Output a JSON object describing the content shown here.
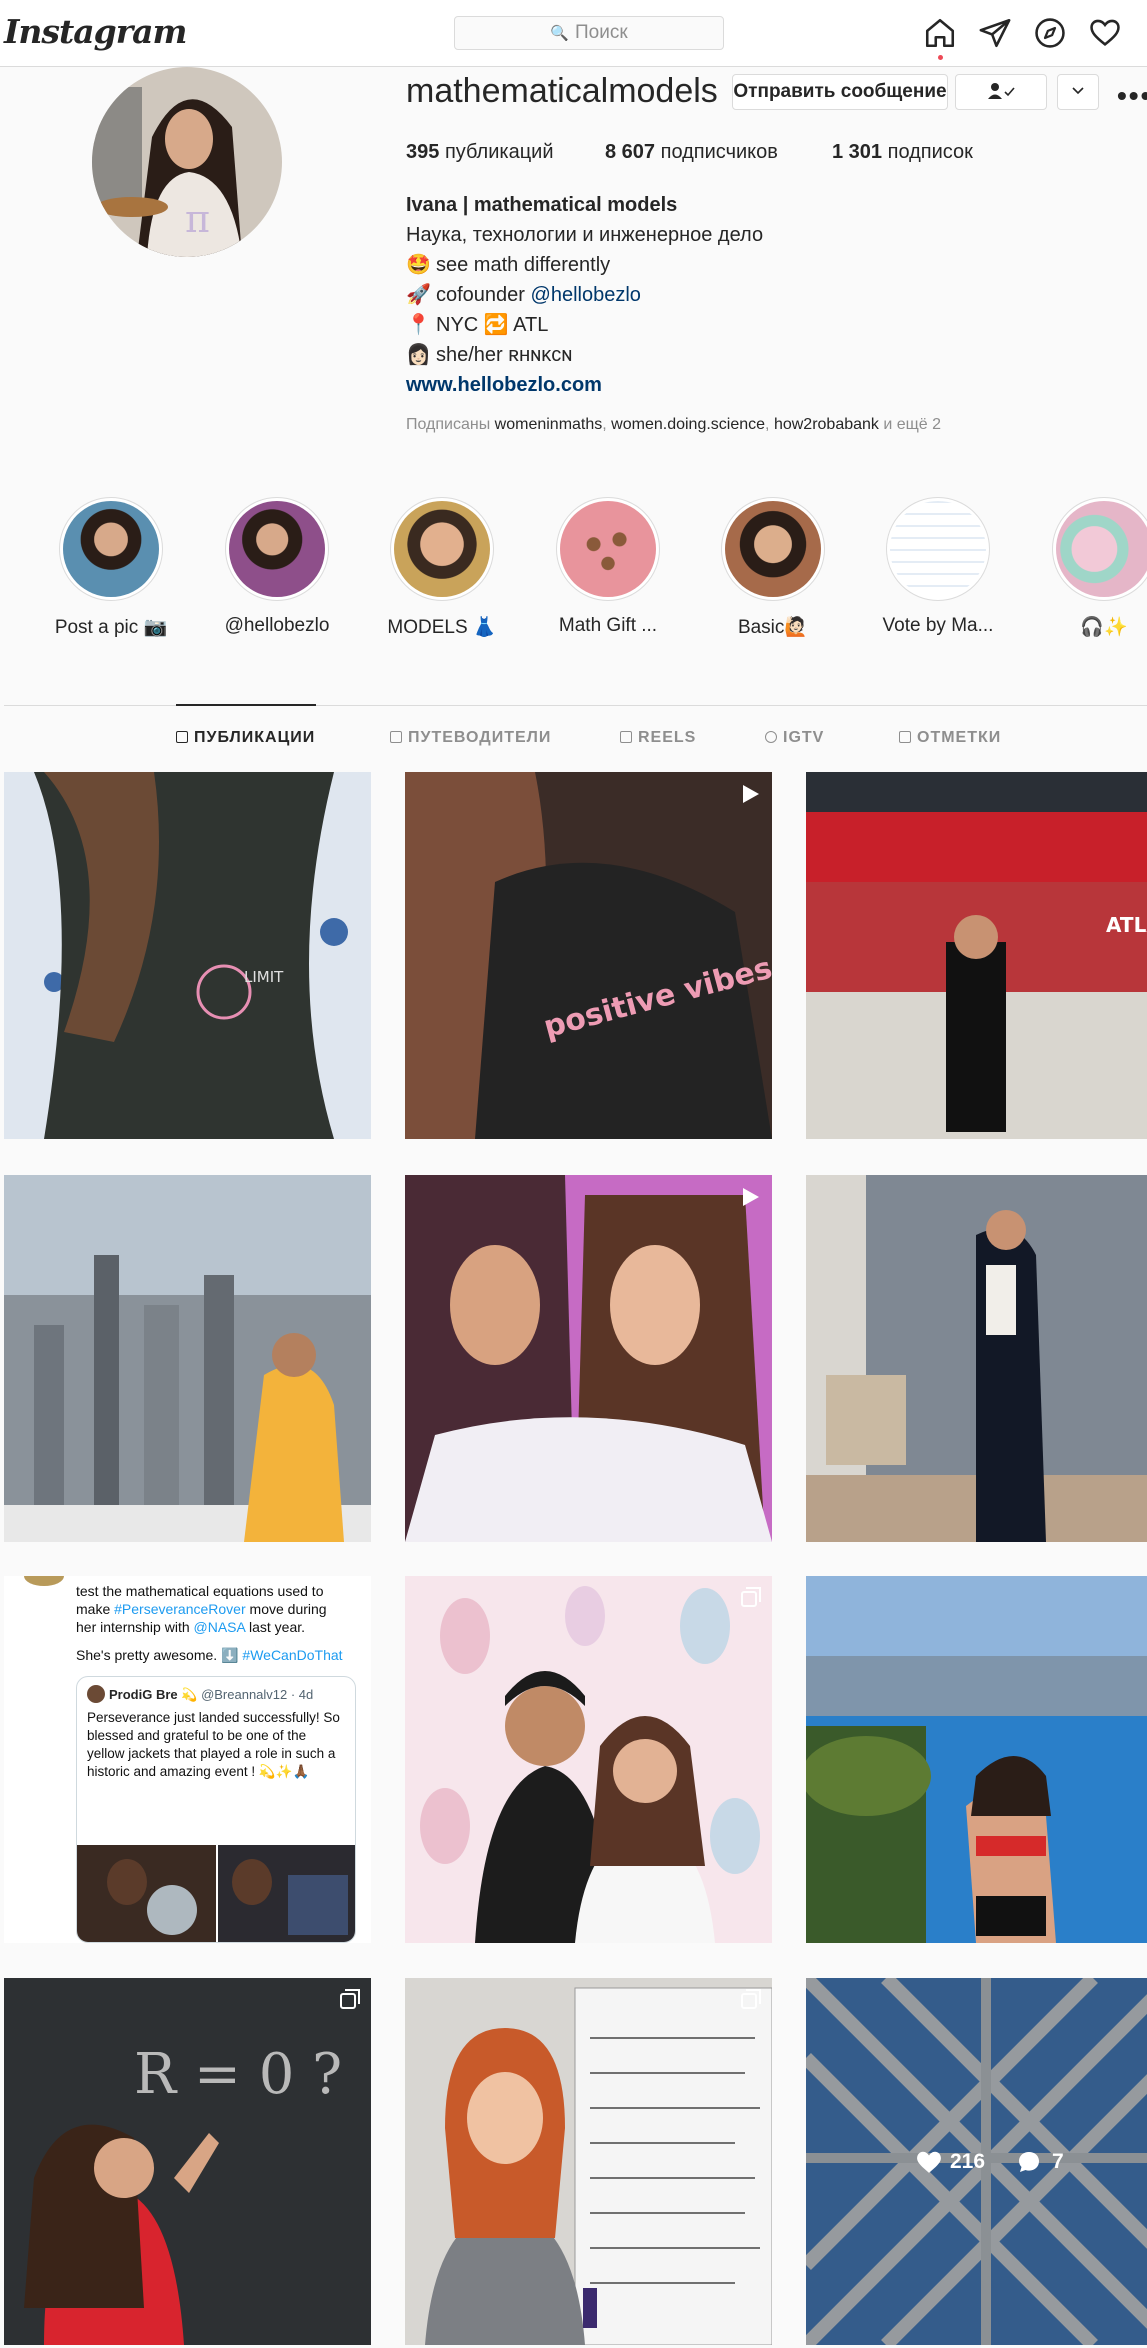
{
  "app": {
    "logo": "Instagram"
  },
  "search": {
    "placeholder": "Поиск"
  },
  "profile": {
    "username": "mathematicalmodels",
    "message_button": "Отправить сообщение",
    "stats": [
      {
        "value": "395",
        "label": "публикаций"
      },
      {
        "value": "8 607",
        "label": "подписчиков"
      },
      {
        "value": "1 301",
        "label": "подписок"
      }
    ],
    "full_name": "Ivana | mathematical models",
    "category": "Наука, технологии и инженерное дело",
    "bio_lines": [
      {
        "emoji": "🤩",
        "text": "see math differently",
        "mention": ""
      },
      {
        "emoji": "🚀",
        "text": "cofounder ",
        "mention": "@hellobezlo"
      },
      {
        "emoji": "📍",
        "text": "NYC 🔁 ATL",
        "mention": ""
      },
      {
        "emoji": "👩🏻",
        "text": "she/her ʀʜɴᴋᴄɴ",
        "mention": ""
      }
    ],
    "website": "www.hellobezlo.com",
    "followed_by": {
      "prefix": "Подписаны",
      "users": [
        "womeninmaths",
        "women.doing.science",
        "how2robabank"
      ],
      "suffix": "и ещё 2"
    }
  },
  "highlights": [
    {
      "label": "Post a pic 📷",
      "color": "#5a8fb0"
    },
    {
      "label": "@hellobezlo",
      "color": "#8e4f8a"
    },
    {
      "label": "MODELS 👗",
      "color": "#c9a35a"
    },
    {
      "label": "Math Gift ...",
      "color": "#e8949c"
    },
    {
      "label": "Basic🙋🏻",
      "color": "#a66a4a"
    },
    {
      "label": "Vote by Ma...",
      "color": "#dfe9f3"
    },
    {
      "label": "🎧✨",
      "color": "#e5b6c8"
    }
  ],
  "tabs": [
    {
      "label": "ПУБЛИКАЦИИ",
      "active": true
    },
    {
      "label": "ПУТЕВОДИТЕЛИ",
      "active": false
    },
    {
      "label": "REELS",
      "active": false
    },
    {
      "label": "IGTV",
      "active": false
    },
    {
      "label": "ОТМЕТКИ",
      "active": false
    }
  ],
  "tweet_post": {
    "line1": "test the mathematical equations used to",
    "line2_pre": "make ",
    "line2_tag": "#PerseveranceRover",
    "line2_post": " move during",
    "line3_pre": "her internship with ",
    "line3_tag": "@NASA",
    "line3_post": " last year.",
    "line4_pre": "She's pretty awesome. ⬇️ ",
    "line4_tag": "#WeCanDoThat",
    "quote_author": "ProdiG Bre 💫",
    "quote_handle": "@Breannalv12 · 4d",
    "quote_text": "Perseverance just landed successfully! So blessed and grateful to be one of the yellow jackets that played a role in such a historic and amazing event ! 💫✨🙏🏾"
  },
  "hover_stats": {
    "likes": "216",
    "comments": "7"
  },
  "photo_text": {
    "shirt_text": "positive vibes ONLY",
    "stadium_sign": "ATLANTA",
    "board_text": "R = 0 ?"
  },
  "colors": {
    "link": "#00376b",
    "muted": "#8e8e8e",
    "border": "#dbdbdb",
    "notification": "#ed4956"
  }
}
